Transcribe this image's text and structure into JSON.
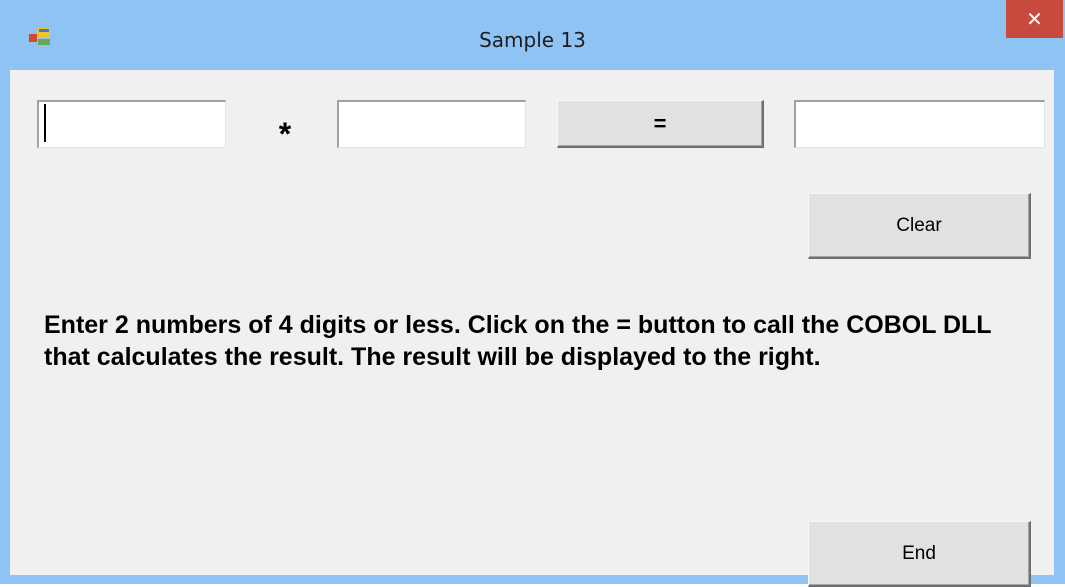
{
  "window": {
    "title": "Sample 13",
    "close_label": "✕",
    "icon": "windows-form-icon"
  },
  "form": {
    "operand1": {
      "value": "",
      "placeholder": ""
    },
    "operator": "*",
    "operand2": {
      "value": "",
      "placeholder": ""
    },
    "equals_label": "=",
    "result": {
      "value": "",
      "placeholder": ""
    },
    "clear_label": "Clear",
    "instructions": "Enter 2 numbers of 4 digits or less. Click on the = button to call the COBOL DLL that calculates the result. The result will be displayed to the right.",
    "end_label": "End"
  },
  "colors": {
    "titlebar": "#8fc3f3",
    "client": "#f0f0f0",
    "close": "#c84a3f"
  }
}
